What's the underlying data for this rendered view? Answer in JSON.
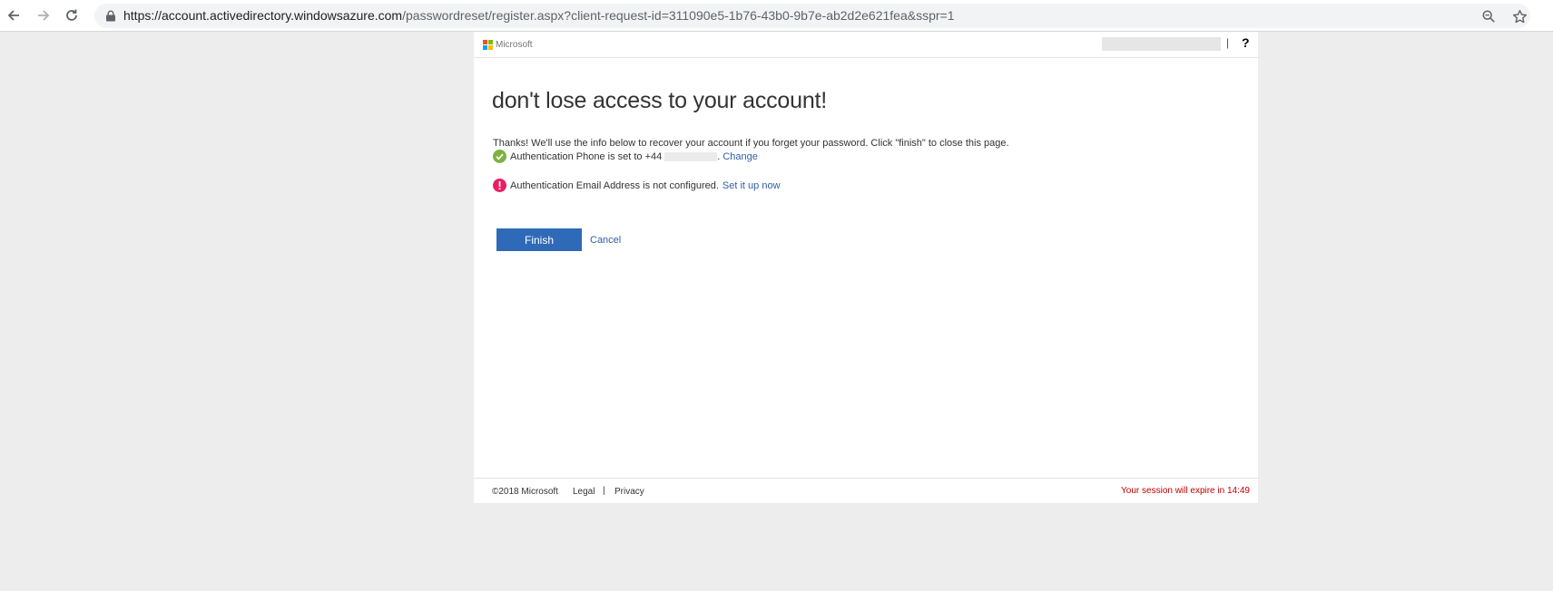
{
  "browser": {
    "url_host": "https://account.activedirectory.windowsazure.com",
    "url_path": "/passwordreset/register.aspx?client-request-id=311090e5-1b76-43b0-9b7e-ab2d2e621fea&sspr=1",
    "icons": {
      "back": "arrow-left-icon",
      "forward": "arrow-right-icon",
      "reload": "reload-icon",
      "secure": "lock-icon",
      "zoom": "magnifier-icon",
      "bookmark": "star-icon"
    }
  },
  "header": {
    "brand": "Microsoft",
    "help_label": "?",
    "separator": "|",
    "logo_colors": [
      "#f25022",
      "#7fba00",
      "#00a4ef",
      "#ffb900"
    ]
  },
  "main": {
    "title": "don't lose access to your account!",
    "intro": "Thanks! We'll use the info below to recover your account if you forget your password. Click \"finish\" to close this page.",
    "phone": {
      "text_prefix": "Authentication Phone is set to +44",
      "text_suffix": ".",
      "link": "Change",
      "status_color": "#7cb342"
    },
    "email": {
      "text": "Authentication Email Address is not configured.",
      "link": "Set it up now",
      "status_color": "#e91e63"
    },
    "finish_label": "Finish",
    "cancel_label": "Cancel"
  },
  "footer": {
    "copyright": "©2018 Microsoft",
    "legal": "Legal",
    "separator": "|",
    "privacy": "Privacy",
    "session_prefix": "Your session will expire in",
    "session_time": "14:49"
  },
  "colors": {
    "accent": "#2f6ab8",
    "link": "#2f5fa5",
    "warning_text": "#c00000",
    "background": "#ededed"
  }
}
